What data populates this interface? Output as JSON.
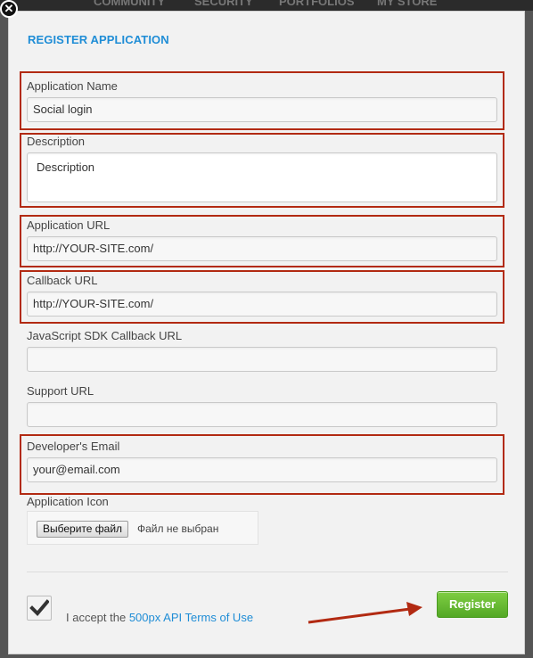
{
  "background_nav": [
    "COMMUNITY",
    "SECURITY",
    "PORTFOLIOS",
    "MY STORE"
  ],
  "modal": {
    "close_icon": "close-icon",
    "title": "REGISTER APPLICATION"
  },
  "form": {
    "app_name": {
      "label": "Application Name",
      "value": "Social login"
    },
    "description": {
      "label": "Description",
      "placeholder": "Description"
    },
    "app_url": {
      "label": "Application URL",
      "value": "http://YOUR-SITE.com/"
    },
    "callback_url": {
      "label": "Callback URL",
      "value": "http://YOUR-SITE.com/"
    },
    "js_sdk_callback_url": {
      "label": "JavaScript SDK Callback URL",
      "value": ""
    },
    "support_url": {
      "label": "Support URL",
      "value": ""
    },
    "developer_email": {
      "label": "Developer's Email",
      "value": "your@email.com"
    },
    "app_icon": {
      "label": "Application Icon",
      "button_label": "Выберите файл",
      "status": "Файл не выбран"
    }
  },
  "footer": {
    "checkbox_checked": true,
    "accept_text": "I accept the ",
    "terms_link": "500px API Terms of Use",
    "register_label": "Register"
  },
  "colors": {
    "accent": "#1f8dd6",
    "highlight": "#b22a12",
    "register_green": "#5cb82e"
  }
}
